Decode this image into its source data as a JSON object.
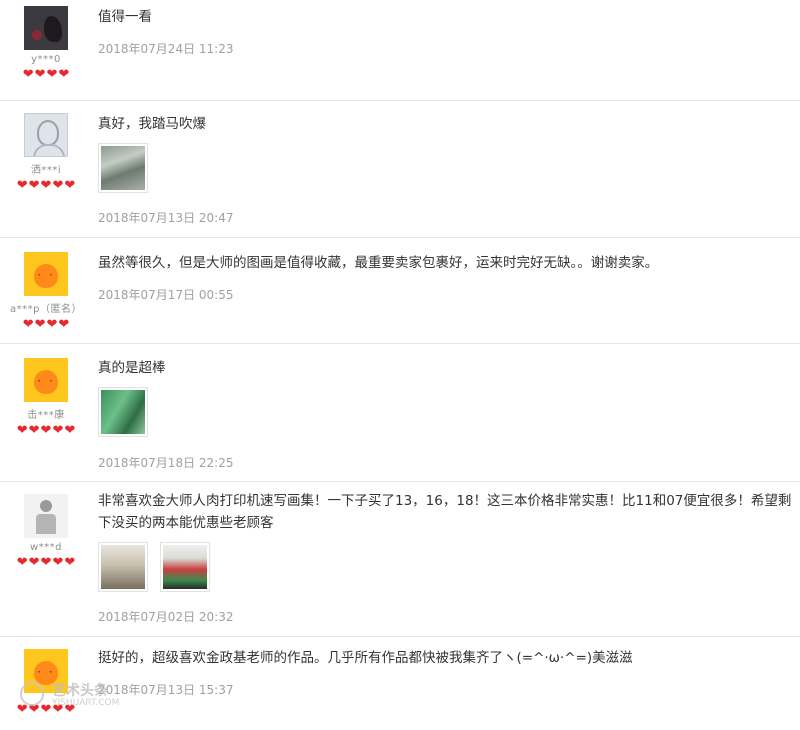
{
  "reviews": [
    {
      "avatar_icon": "dark-bird-avatar",
      "username": "y***0",
      "hearts": [
        "❤",
        "❤",
        "❤",
        "❤"
      ],
      "text": "值得一看",
      "date": "2018年07月24日 11:23"
    },
    {
      "avatar_icon": "sketch-portrait-avatar",
      "username": "洒***i",
      "hearts": [
        "❤",
        "❤",
        "❤",
        "❤",
        "❤"
      ],
      "text": "真好，我踏马吹爆",
      "photos": [
        "rocks"
      ],
      "date": "2018年07月13日 20:47"
    },
    {
      "avatar_icon": "orange-default-avatar",
      "username": "a***p（匿名）",
      "hearts": [
        "❤",
        "❤",
        "❤",
        "❤"
      ],
      "text": "虽然等很久，但是大师的图画是值得收藏，最重要卖家包裹好，运来时完好无缺。。谢谢卖家。",
      "date": "2018年07月17日 00:55"
    },
    {
      "avatar_icon": "orange-default-avatar",
      "username": "击***康",
      "hearts": [
        "❤",
        "❤",
        "❤",
        "❤",
        "❤"
      ],
      "text": "真的是超棒",
      "photos": [
        "green"
      ],
      "date": "2018年07月18日 22:25"
    },
    {
      "avatar_icon": "figure-avatar",
      "username": "w***d",
      "hearts": [
        "❤",
        "❤",
        "❤",
        "❤",
        "❤"
      ],
      "text": "非常喜欢金大师人肉打印机速写画集！一下子买了13，16，18！这三本价格非常实惠！比11和07便宜很多！希望剩下没买的两本能优惠些老顾客",
      "photos": [
        "figure",
        "books"
      ],
      "date": "2018年07月02日 20:32"
    },
    {
      "avatar_icon": "orange-default-avatar",
      "username": "",
      "hearts": [
        "❤",
        "❤",
        "❤",
        "❤",
        "❤"
      ],
      "text": "挺好的，超级喜欢金政基老师的作品。几乎所有作品都快被我集齐了ヽ(=^·ω·^=)美滋滋",
      "date": "2018年07月13日 15:37"
    }
  ],
  "watermark": {
    "icon": "watermark-logo-icon",
    "title": "艺术头条",
    "subtitle": "YISHUART.COM"
  }
}
